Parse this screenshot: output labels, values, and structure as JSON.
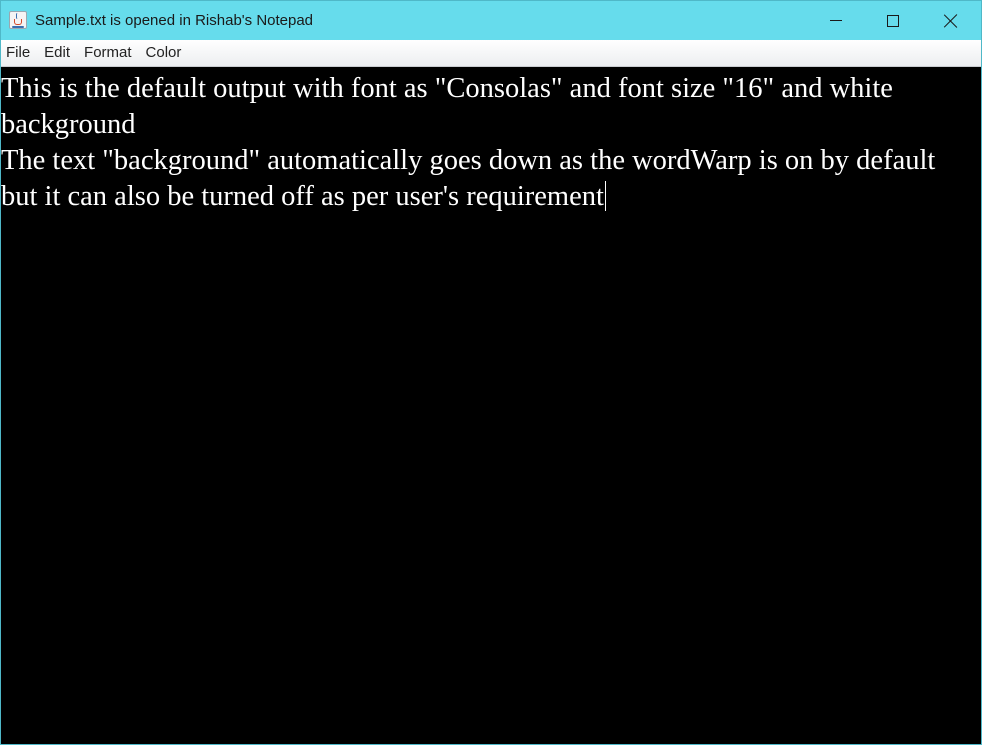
{
  "window": {
    "title": "Sample.txt is opened in Rishab's Notepad",
    "icon": "java-cup-icon",
    "titlebar_color": "#66dcec",
    "controls": [
      "minimize-icon",
      "maximize-icon",
      "close-icon"
    ]
  },
  "menubar": {
    "items": [
      "File",
      "Edit",
      "Format",
      "Color"
    ]
  },
  "editor": {
    "background": "#000000",
    "text_color": "#ffffff",
    "lines": [
      "This is the default output with font as \"Consolas\" and font size \"16\" and white",
      "background",
      "The text \"background\" automatically goes down as the wordWarp is on by default",
      "but it can also be turned off as per user's requirement"
    ]
  }
}
